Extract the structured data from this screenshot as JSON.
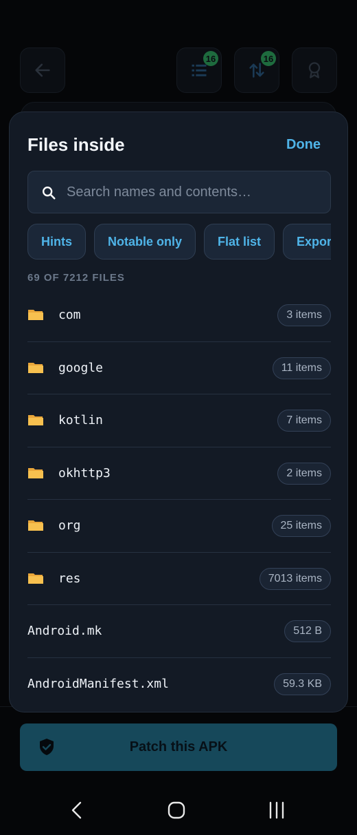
{
  "background": {
    "filters_badge": "16",
    "sort_badge": "16"
  },
  "sheet": {
    "title": "Files inside",
    "done_label": "Done",
    "search": {
      "placeholder": "Search names and contents…",
      "value": ""
    },
    "chips": [
      "Hints",
      "Notable only",
      "Flat list",
      "Export"
    ],
    "count_label": "69 OF 7212 FILES",
    "files": [
      {
        "name": "com",
        "type": "folder",
        "size": "3 items"
      },
      {
        "name": "google",
        "type": "folder",
        "size": "11 items"
      },
      {
        "name": "kotlin",
        "type": "folder",
        "size": "7 items"
      },
      {
        "name": "okhttp3",
        "type": "folder",
        "size": "2 items"
      },
      {
        "name": "org",
        "type": "folder",
        "size": "25 items"
      },
      {
        "name": "res",
        "type": "folder",
        "size": "7013 items"
      },
      {
        "name": "Android.mk",
        "type": "file",
        "size": "512 B"
      },
      {
        "name": "AndroidManifest.xml",
        "type": "file",
        "size": "59.3 KB"
      }
    ]
  },
  "patch_button": {
    "label": "Patch this APK",
    "icon": "shield-check-icon"
  },
  "colors": {
    "accent": "#4fb4e8",
    "sheet_bg": "#131a25",
    "badge_green": "#1e6b3e",
    "patch_bg": "#16485a"
  },
  "nav_icons": [
    "back-nav-icon",
    "home-nav-icon",
    "recents-nav-icon"
  ]
}
